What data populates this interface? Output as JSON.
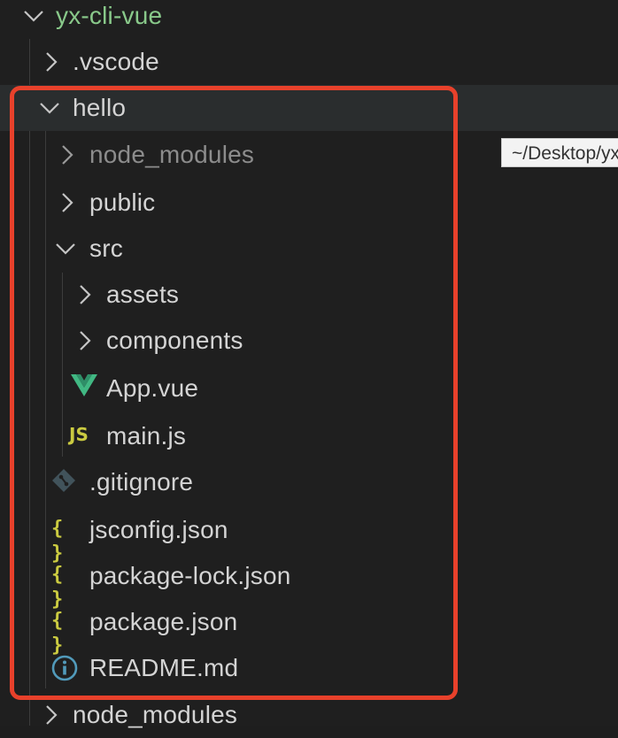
{
  "explorer": {
    "root": {
      "label": "yx-cli-vue"
    },
    "vscode": {
      "label": ".vscode"
    },
    "hello": {
      "label": "hello",
      "node_modules": {
        "label": "node_modules"
      },
      "public": {
        "label": "public"
      },
      "src": {
        "label": "src",
        "assets": {
          "label": "assets"
        },
        "components": {
          "label": "components"
        },
        "app_vue": {
          "label": "App.vue"
        },
        "main_js": {
          "label": "main.js",
          "icon_text": "JS"
        }
      },
      "gitignore": {
        "label": ".gitignore"
      },
      "jsconfig": {
        "label": "jsconfig.json",
        "icon_text": "{ }"
      },
      "package_lock": {
        "label": "package-lock.json",
        "icon_text": "{ }"
      },
      "package": {
        "label": "package.json",
        "icon_text": "{ }"
      },
      "readme": {
        "label": "README.md"
      }
    },
    "node_modules_bottom": {
      "label": "node_modules"
    }
  },
  "tooltip": {
    "text": "~/Desktop/yx-cli-vue"
  },
  "colors": {
    "background": "#1f1f1f",
    "selected_row": "#2a2d2e",
    "root_label": "#89c98a",
    "highlight_box": "#e8412b",
    "vue_green": "#41b883",
    "json_yellow": "#cbcb41",
    "git_blue": "#41535b",
    "info_blue": "#519aba"
  }
}
